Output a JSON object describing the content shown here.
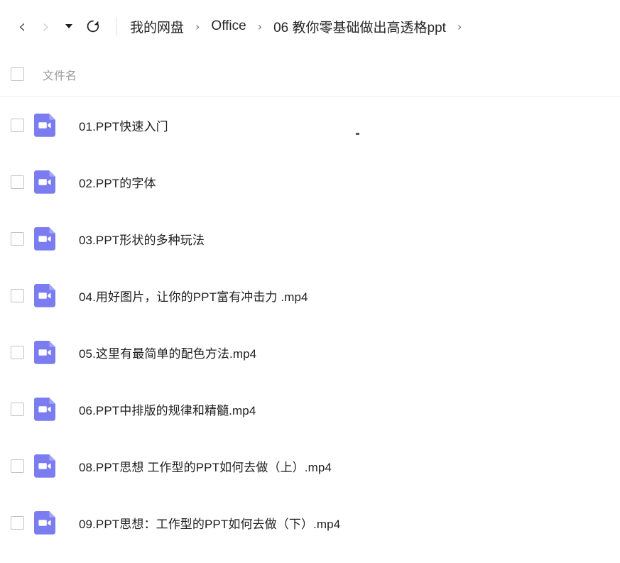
{
  "toolbar": {
    "back_icon": "chevron-left-icon",
    "back_label": "‹",
    "forward_icon": "chevron-right-icon",
    "forward_label": "›",
    "history_dropdown_icon": "caret-down-icon",
    "refresh_icon": "refresh-icon",
    "breadcrumb": {
      "separator": "›",
      "items": [
        {
          "label": "我的网盘"
        },
        {
          "label": "Office"
        },
        {
          "label": "06 教你零基础做出高透格ppt"
        }
      ]
    }
  },
  "list": {
    "select_all_checked": false,
    "columns": [
      {
        "label": "文件名"
      }
    ],
    "rows": [
      {
        "name": "01.PPT快速入门",
        "icon": "video-file-icon",
        "checked": false
      },
      {
        "name": "02.PPT的字体",
        "icon": "video-file-icon",
        "checked": false
      },
      {
        "name": "03.PPT形状的多种玩法",
        "icon": "video-file-icon",
        "checked": false
      },
      {
        "name": "04.用好图片，让你的PPT富有冲击力 .mp4",
        "icon": "video-file-icon",
        "checked": false
      },
      {
        "name": "05.这里有最简单的配色方法.mp4",
        "icon": "video-file-icon",
        "checked": false
      },
      {
        "name": "06.PPT中排版的规律和精髓.mp4",
        "icon": "video-file-icon",
        "checked": false
      },
      {
        "name": "08.PPT思想 工作型的PPT如何去做（上）.mp4",
        "icon": "video-file-icon",
        "checked": false
      },
      {
        "name": "09.PPT思想：工作型的PPT如何去做（下）.mp4",
        "icon": "video-file-icon",
        "checked": false
      }
    ]
  },
  "colors": {
    "file_icon_purple": "#7b7cf0",
    "file_icon_purple_fold": "#a3a4f6",
    "header_text": "#9b9b9b",
    "body_text": "#1f1f1f",
    "divider": "#f0f0f0"
  }
}
